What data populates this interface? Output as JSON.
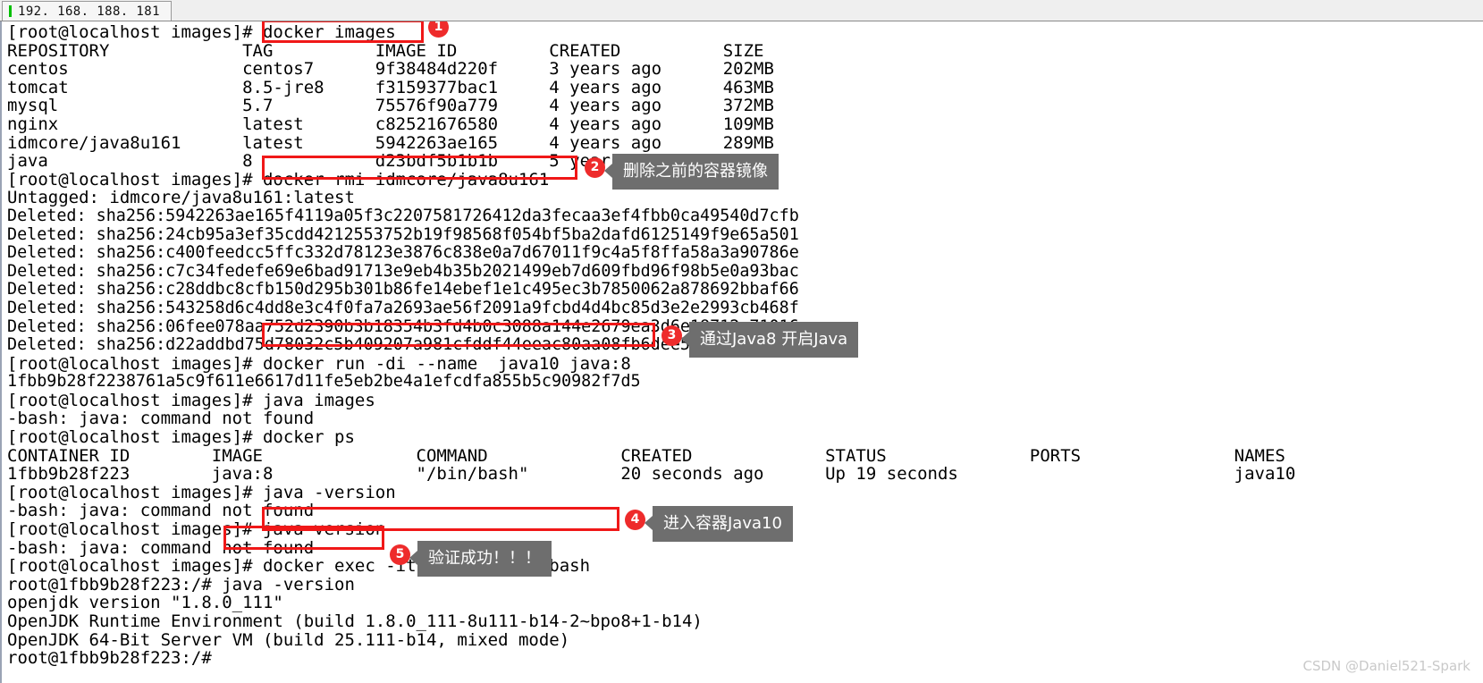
{
  "window": {
    "tab_label": "192. 168. 188. 181",
    "tab_marker_color": "#00c000"
  },
  "colors": {
    "highlight_box": "#f01818",
    "badge": "#ee2b2b",
    "bubble": "#6e6e6e",
    "terminal_bg": "#ffffff",
    "terminal_fg": "#000000",
    "watermark": "#c9c9c9"
  },
  "terminal": {
    "lines": [
      "[root@localhost images]# docker images",
      "REPOSITORY             TAG          IMAGE ID         CREATED          SIZE",
      "centos                 centos7      9f38484d220f     3 years ago      202MB",
      "tomcat                 8.5-jre8     f3159377bac1     4 years ago      463MB",
      "mysql                  5.7          75576f90a779     4 years ago      372MB",
      "nginx                  latest       c82521676580     4 years ago      109MB",
      "idmcore/java8u161      latest       5942263ae165     4 years ago      289MB",
      "java                   8            d23bdf5b1b1b     5 years ago      643MB",
      "[root@localhost images]# docker rmi idmcore/java8u161",
      "Untagged: idmcore/java8u161:latest",
      "Deleted: sha256:5942263ae165f4119a05f3c2207581726412da3fecaa3ef4fbb0ca49540d7cfb",
      "Deleted: sha256:24cb95a3ef35cdd4212553752b19f98568f054bf5ba2dafd6125149f9e65a501",
      "Deleted: sha256:c400feedcc5ffc332d78123e3876c838e0a7d67011f9c4a5f8ffa58a3a90786e",
      "Deleted: sha256:c7c34fedefe69e6bad91713e9eb4b35b2021499eb7d609fbd96f98b5e0a93bac",
      "Deleted: sha256:c28ddbc8cfb150d295b301b86fe14ebef1e1c495ec3b7850062a878692bbaf66",
      "Deleted: sha256:543258d6c4dd8e3c4f0fa7a2693ae56f2091a9fcbd4d4bc85d3e2e2993cb468f",
      "Deleted: sha256:06fee078aa752d2390b3b18354b3fd4b0c3088a144e2679ea3d6e18712e71016",
      "Deleted: sha256:d22addbd75d78032c5b409207a981cfddf44eeac80aa08fb6dee57d43a5aa3dd",
      "[root@localhost images]# docker run -di --name  java10 java:8",
      "1fbb9b28f2238761a5c9f611e6617d11fe5eb2be4a1efcdfa855b5c90982f7d5",
      "[root@localhost images]# java images",
      "-bash: java: command not found",
      "[root@localhost images]# docker ps",
      "CONTAINER ID        IMAGE               COMMAND             CREATED             STATUS              PORTS               NAMES",
      "1fbb9b28f223        java:8              \"/bin/bash\"         20 seconds ago      Up 19 seconds                           java10",
      "[root@localhost images]# java -version",
      "-bash: java: command not found",
      "[root@localhost images]# java version",
      "-bash: java: command not found",
      "[root@localhost images]# docker exec -it java10 /bin/bash",
      "root@1fbb9b28f223:/# java -version",
      "openjdk version \"1.8.0_111\"",
      "OpenJDK Runtime Environment (build 1.8.0_111-8u111-b14-2~bpo8+1-b14)",
      "OpenJDK 64-Bit Server VM (build 25.111-b14, mixed mode)",
      "root@1fbb9b28f223:/#"
    ]
  },
  "annotations": [
    {
      "number": "1",
      "text": "",
      "target": "docker images"
    },
    {
      "number": "2",
      "text": "删除之前的容器镜像",
      "target": "docker rmi idmcore/java8u161"
    },
    {
      "number": "3",
      "text": "通过Java8 开启Java",
      "target": "docker run -di --name  java10 java:8"
    },
    {
      "number": "4",
      "text": "进入容器Java10",
      "target": "docker exec -it java10 /bin/bash"
    },
    {
      "number": "5",
      "text": "验证成功！！！",
      "target": "java -version"
    }
  ],
  "watermark": "CSDN @Daniel521-Spark"
}
